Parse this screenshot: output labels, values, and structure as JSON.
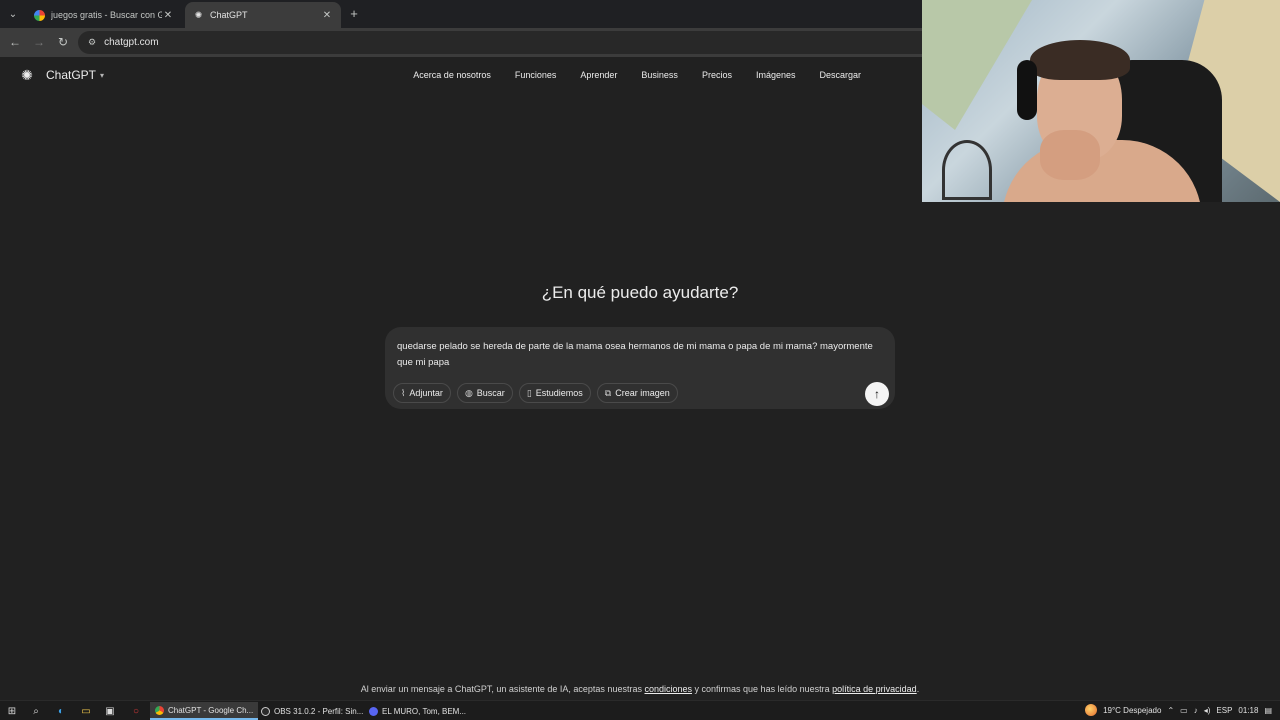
{
  "browser": {
    "tabs": [
      {
        "title": "juegos gratis - Buscar con Goo",
        "close": "✕"
      },
      {
        "title": "ChatGPT",
        "close": "✕"
      }
    ],
    "new_tab": "+",
    "url": "chatgpt.com"
  },
  "header": {
    "brand": "ChatGPT",
    "nav": [
      "Acerca de nosotros",
      "Funciones",
      "Aprender",
      "Business",
      "Precios",
      "Imágenes",
      "Descargar"
    ]
  },
  "main": {
    "title": "¿En qué puedo ayudarte?",
    "composer": {
      "text": "quedarse pelado se hereda de parte de la mama osea hermanos de mi mama o papa de mi mama? mayormente que mi papa",
      "tools": [
        "Adjuntar",
        "Buscar",
        "Estudiemos",
        "Crear imagen"
      ]
    }
  },
  "footer": {
    "prefix": "Al enviar un mensaje a ChatGPT, un asistente de IA, aceptas nuestras",
    "link1": "condiciones",
    "middle": "y confirmas que has leído nuestra",
    "link2": "política de privacidad",
    "suffix": "."
  },
  "taskbar": {
    "apps": [
      "ChatGPT - Google Ch...",
      "OBS 31.0.2 - Perfil: Sin...",
      "EL MURO, Tom, BEM..."
    ],
    "weather": "19°C  Despejado",
    "lang": "ESP",
    "time": "01:18"
  },
  "colors": {
    "background": "#212121",
    "composer": "#303030",
    "accent": "#76b9ed"
  },
  "icons": [
    "chatgpt-logo-icon",
    "paperclip-icon",
    "globe-icon",
    "book-icon",
    "image-icon",
    "arrow-up-icon"
  ]
}
